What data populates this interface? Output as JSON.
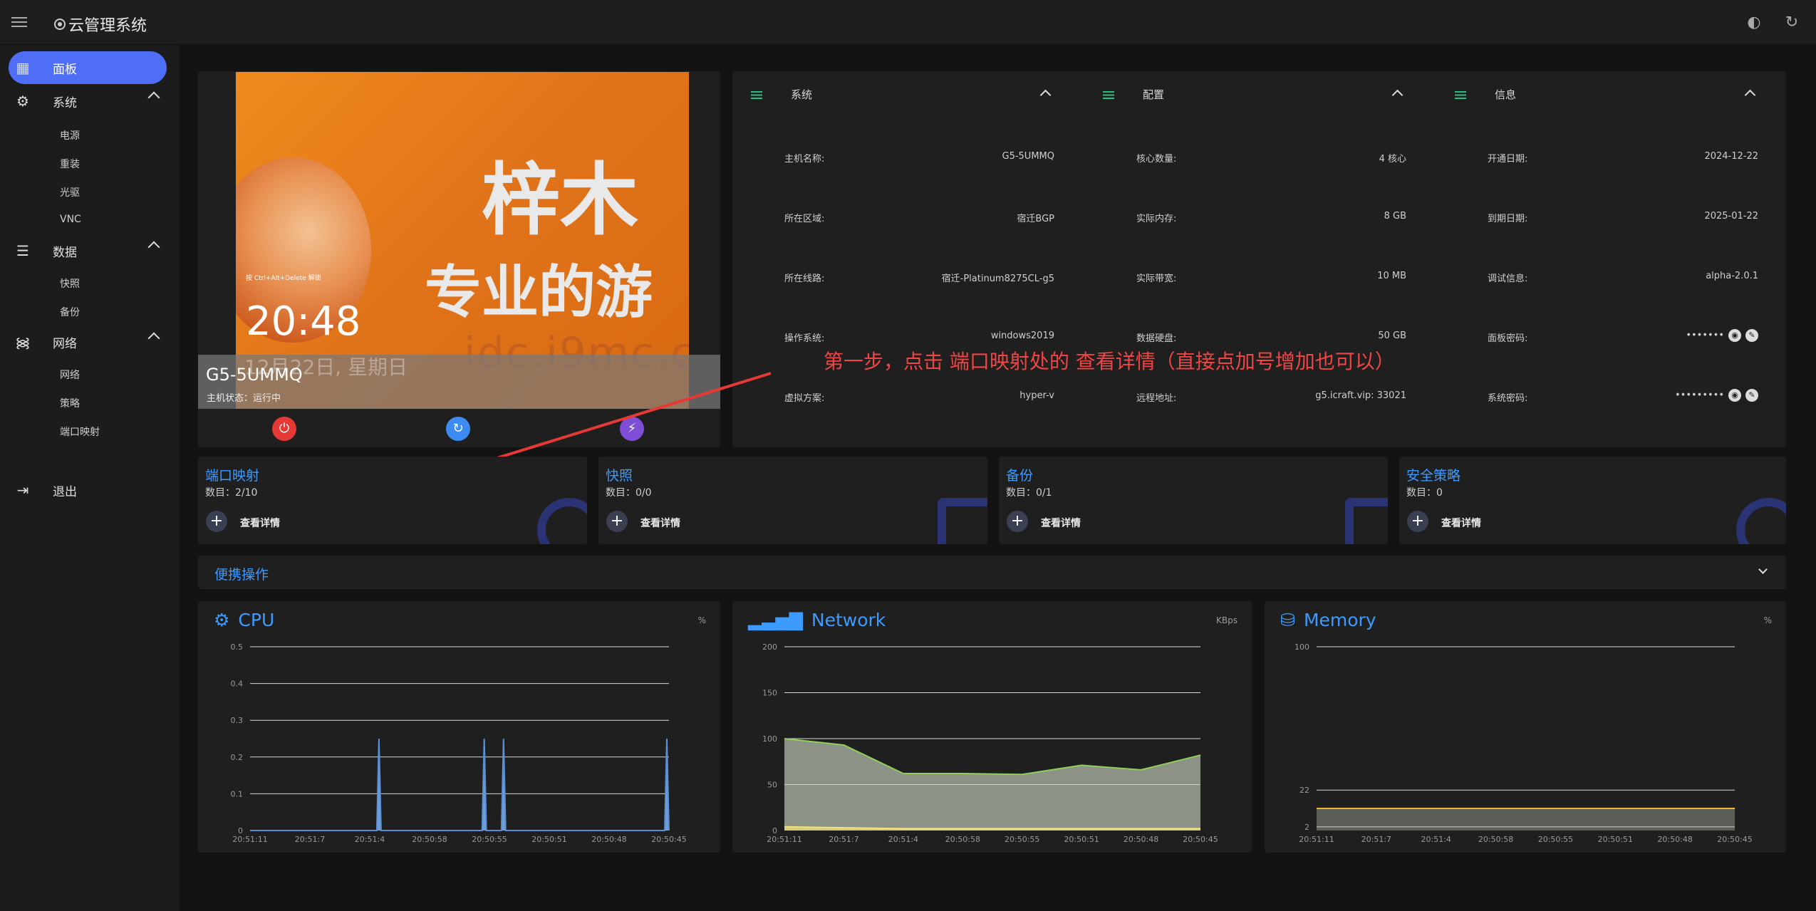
{
  "app": {
    "title": "云管理系统"
  },
  "sidebar": {
    "items": [
      {
        "label": "面板",
        "icon": "dashboard-icon",
        "active": true
      },
      {
        "label": "系统",
        "icon": "gear-icon",
        "children": [
          "电源",
          "重装",
          "光驱",
          "VNC"
        ]
      },
      {
        "label": "数据",
        "icon": "storage-icon",
        "children": [
          "快照",
          "备份"
        ]
      },
      {
        "label": "网络",
        "icon": "wifi-icon",
        "children": [
          "网络",
          "策略",
          "端口映射"
        ]
      },
      {
        "label": "退出",
        "icon": "logout-icon"
      }
    ]
  },
  "vm": {
    "name": "G5-5UMMQ",
    "status": "主机状态：运行中",
    "screen": {
      "time": "20:48",
      "date": "12月22日, 星期日",
      "hint": "按 Ctrl+Alt+Delete 解锁",
      "line1": "梓木",
      "line2": "专业的游",
      "watermark": "idc.i9mc.c"
    }
  },
  "info": {
    "sections": [
      "系统",
      "配置",
      "信息"
    ],
    "system": [
      {
        "k": "主机名称:",
        "v": "G5-5UMMQ"
      },
      {
        "k": "所在区域:",
        "v": "宿迁BGP"
      },
      {
        "k": "所在线路:",
        "v": "宿迁-Platinum8275CL-g5"
      },
      {
        "k": "操作系统:",
        "v": "windows2019"
      },
      {
        "k": "虚拟方案:",
        "v": "hyper-v"
      }
    ],
    "config": [
      {
        "k": "核心数量:",
        "v": "4 核心"
      },
      {
        "k": "实际内存:",
        "v": "8 GB"
      },
      {
        "k": "实际带宽:",
        "v": "10 MB"
      },
      {
        "k": "数据硬盘:",
        "v": "50 GB"
      },
      {
        "k": "远程地址:",
        "v": "g5.icraft.vip: 33021"
      }
    ],
    "information": [
      {
        "k": "开通日期:",
        "v": "2024-12-22"
      },
      {
        "k": "到期日期:",
        "v": "2025-01-22"
      },
      {
        "k": "调试信息:",
        "v": "alpha-2.0.1"
      },
      {
        "k": "面板密码:",
        "v": "•••••••"
      },
      {
        "k": "系统密码:",
        "v": "•••••••••"
      }
    ]
  },
  "annotation": "第一步，点击 端口映射处的 查看详情（直接点加号增加也可以）",
  "cards": [
    {
      "title": "端口映射",
      "count": "数目：2/10",
      "action": "查看详情"
    },
    {
      "title": "快照",
      "count": "数目：0/0",
      "action": "查看详情"
    },
    {
      "title": "备份",
      "count": "数目：0/1",
      "action": "查看详情"
    },
    {
      "title": "安全策略",
      "count": "数目：0",
      "action": "查看详情"
    }
  ],
  "quick": {
    "label": "便携操作"
  },
  "chart_data": [
    {
      "type": "area",
      "title": "CPU",
      "unit": "%",
      "ylim": [
        0,
        0.5
      ],
      "yticks": [
        0,
        0.1,
        0.2,
        0.3,
        0.4,
        0.5
      ],
      "x": [
        "20:51:11",
        "20:51:7",
        "20:51:4",
        "20:50:58",
        "20:50:55",
        "20:50:51",
        "20:50:48",
        "20:50:45"
      ],
      "series": [
        {
          "values": [
            0,
            0,
            0,
            0,
            0,
            0,
            0,
            0,
            0,
            0,
            0,
            0,
            0,
            0,
            0,
            0,
            0,
            0,
            0,
            0,
            0,
            0,
            0,
            0,
            0,
            0,
            0,
            0,
            0,
            0,
            0,
            0,
            0,
            0,
            0,
            0,
            0,
            0,
            0,
            0,
            0,
            0,
            0,
            0,
            0,
            0,
            0,
            0,
            0,
            0,
            0,
            0,
            0,
            0,
            0,
            0,
            0,
            0,
            0,
            0,
            0.25,
            0,
            0,
            0,
            0,
            0,
            0,
            0,
            0,
            0,
            0,
            0,
            0,
            0,
            0,
            0,
            0,
            0,
            0,
            0,
            0,
            0,
            0,
            0,
            0,
            0,
            0,
            0,
            0,
            0,
            0,
            0,
            0,
            0,
            0,
            0,
            0,
            0,
            0,
            0,
            0,
            0,
            0,
            0,
            0,
            0,
            0,
            0,
            0,
            0.25,
            0,
            0,
            0,
            0,
            0,
            0,
            0,
            0,
            0.25,
            0,
            0,
            0,
            0,
            0,
            0,
            0,
            0,
            0,
            0,
            0,
            0,
            0,
            0,
            0,
            0,
            0,
            0,
            0,
            0,
            0,
            0,
            0,
            0,
            0,
            0,
            0,
            0,
            0,
            0,
            0,
            0,
            0,
            0,
            0,
            0,
            0,
            0,
            0,
            0,
            0,
            0,
            0,
            0,
            0,
            0,
            0,
            0,
            0,
            0,
            0,
            0,
            0,
            0,
            0,
            0,
            0,
            0,
            0,
            0,
            0,
            0,
            0,
            0,
            0,
            0,
            0,
            0,
            0,
            0,
            0,
            0,
            0,
            0,
            0,
            0.25,
            0
          ]
        }
      ]
    },
    {
      "type": "area",
      "title": "Network",
      "unit": "KBps",
      "ylim": [
        0,
        200
      ],
      "yticks": [
        0,
        50,
        100,
        150,
        200
      ],
      "x": [
        "20:51:11",
        "20:51:7",
        "20:51:4",
        "20:50:58",
        "20:50:55",
        "20:50:51",
        "20:50:48",
        "20:50:45"
      ],
      "series": [
        {
          "color": "#8fcf5a",
          "values": [
            100,
            93,
            62,
            62,
            61,
            71,
            66,
            82
          ]
        },
        {
          "color": "#f2e27a",
          "values": [
            4,
            3,
            2,
            2,
            2,
            2,
            2,
            2
          ]
        }
      ]
    },
    {
      "type": "area",
      "title": "Memory",
      "unit": "%",
      "ylim": [
        0,
        100
      ],
      "yticks": [
        2,
        22,
        100
      ],
      "x": [
        "20:51:11",
        "20:51:7",
        "20:51:4",
        "20:50:58",
        "20:50:55",
        "20:50:51",
        "20:50:48",
        "20:50:45"
      ],
      "series": [
        {
          "color": "#f2b234",
          "values": [
            12,
            12,
            12,
            12,
            12,
            12,
            12,
            12
          ]
        }
      ]
    }
  ]
}
